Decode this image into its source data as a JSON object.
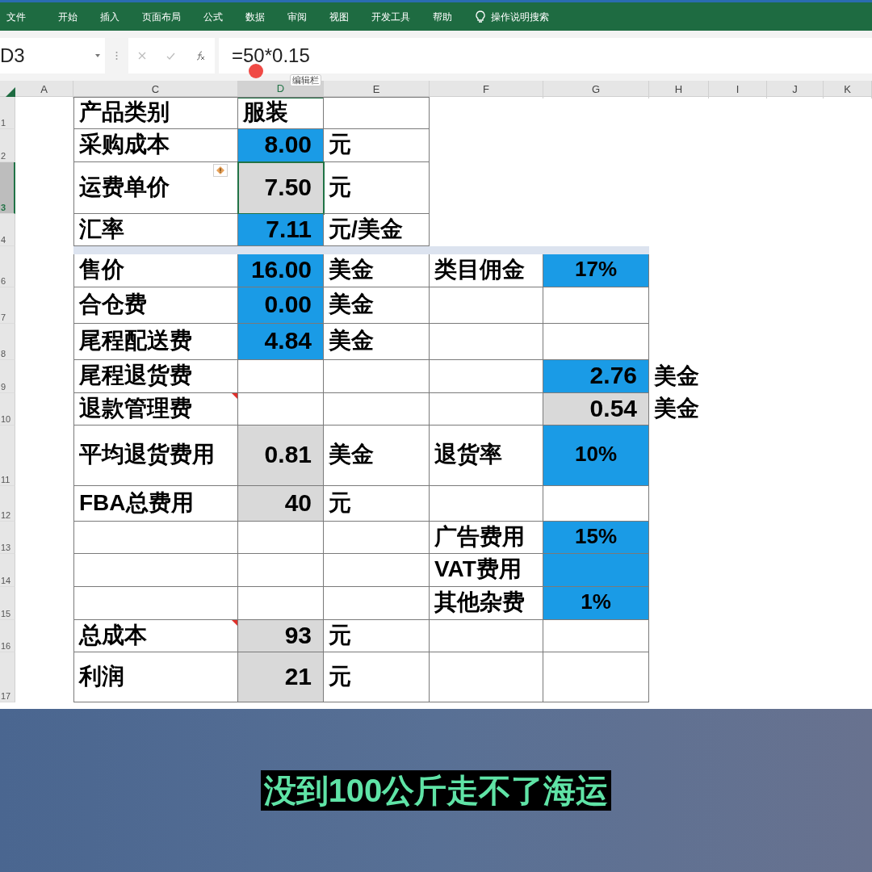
{
  "ribbon": {
    "tabs": [
      "文件",
      "开始",
      "插入",
      "页面布局",
      "公式",
      "数据",
      "审阅",
      "视图",
      "开发工具",
      "帮助"
    ],
    "search": "操作说明搜索"
  },
  "formula_bar": {
    "name_box": "D3",
    "formula": "=50*0.15",
    "tooltip": "编辑栏"
  },
  "columns": [
    {
      "label": "A",
      "selected": false
    },
    {
      "label": "C",
      "selected": false
    },
    {
      "label": "D",
      "selected": true
    },
    {
      "label": "E",
      "selected": false
    },
    {
      "label": "F",
      "selected": false
    },
    {
      "label": "G",
      "selected": false
    },
    {
      "label": "H",
      "selected": false
    },
    {
      "label": "I",
      "selected": false
    },
    {
      "label": "J",
      "selected": false
    },
    {
      "label": "K",
      "selected": false
    }
  ],
  "rows": [
    {
      "number": "1",
      "selected": false,
      "cells": [
        null,
        {
          "kind": "label",
          "text": "产品类别"
        },
        {
          "kind": "label",
          "text": "服装"
        },
        {
          "kind": "blank"
        },
        null,
        null,
        null,
        null,
        null,
        null
      ]
    },
    {
      "number": "2",
      "selected": false,
      "cells": [
        null,
        {
          "kind": "label",
          "text": "采购成本"
        },
        {
          "kind": "number",
          "text": "8.00",
          "color": "#1a9be6"
        },
        {
          "kind": "label",
          "text": "元"
        },
        null,
        null,
        null,
        null,
        null,
        null
      ]
    },
    {
      "number": "3",
      "selected": true,
      "cells": [
        null,
        {
          "kind": "label",
          "text": "运费单价",
          "warning": true
        },
        {
          "kind": "number",
          "text": "7.50",
          "color": "#d9d9d9"
        },
        {
          "kind": "label",
          "text": "元"
        },
        null,
        null,
        null,
        null,
        null,
        null
      ]
    },
    {
      "number": "4",
      "selected": false,
      "cells": [
        null,
        {
          "kind": "label",
          "text": "汇率"
        },
        {
          "kind": "number",
          "text": "7.11",
          "color": "#1a9be6"
        },
        {
          "kind": "label",
          "text": "元/美金"
        },
        null,
        null,
        null,
        null,
        null,
        null
      ]
    },
    {
      "kind": "band",
      "selected": false
    },
    {
      "number": "6",
      "selected": false,
      "cells": [
        null,
        {
          "kind": "label",
          "text": "售价"
        },
        {
          "kind": "number",
          "text": "16.00",
          "color": "#1a9be6"
        },
        {
          "kind": "label",
          "text": "美金"
        },
        {
          "kind": "label",
          "text": "类目佣金"
        },
        {
          "kind": "percent",
          "text": "17%",
          "color": "#1a9be6"
        },
        null,
        null,
        null,
        null
      ]
    },
    {
      "number": "7",
      "selected": false,
      "cells": [
        null,
        {
          "kind": "label",
          "text": "合仓费"
        },
        {
          "kind": "number",
          "text": "0.00",
          "color": "#1a9be6"
        },
        {
          "kind": "label",
          "text": "美金"
        },
        {
          "kind": "blank"
        },
        {
          "kind": "blank"
        },
        null,
        null,
        null,
        null
      ]
    },
    {
      "number": "8",
      "selected": false,
      "cells": [
        null,
        {
          "kind": "label",
          "text": "尾程配送费"
        },
        {
          "kind": "number",
          "text": "4.84",
          "color": "#1a9be6"
        },
        {
          "kind": "label",
          "text": "美金"
        },
        {
          "kind": "blank"
        },
        {
          "kind": "blank"
        },
        null,
        null,
        null,
        null
      ]
    },
    {
      "number": "9",
      "selected": false,
      "cells": [
        null,
        {
          "kind": "label",
          "text": "尾程退货费"
        },
        {
          "kind": "blank"
        },
        {
          "kind": "blank"
        },
        {
          "kind": "blank"
        },
        {
          "kind": "number",
          "text": "2.76",
          "color": "#1a9be6"
        },
        {
          "kind": "note",
          "text": "美金"
        },
        null,
        null,
        null
      ]
    },
    {
      "number": "10",
      "selected": false,
      "cells": [
        null,
        {
          "kind": "label",
          "text": "退款管理费",
          "comment": true
        },
        {
          "kind": "blank"
        },
        {
          "kind": "blank"
        },
        {
          "kind": "blank"
        },
        {
          "kind": "number",
          "text": "0.54",
          "color": "#d9d9d9"
        },
        {
          "kind": "note",
          "text": "美金"
        },
        null,
        null,
        null
      ]
    },
    {
      "number": "11",
      "selected": false,
      "cells": [
        null,
        {
          "kind": "label",
          "text": "平均退货费用"
        },
        {
          "kind": "number",
          "text": "0.81",
          "color": "#d9d9d9"
        },
        {
          "kind": "label",
          "text": "美金"
        },
        {
          "kind": "label",
          "text": "退货率"
        },
        {
          "kind": "percent",
          "text": "10%",
          "color": "#1a9be6"
        },
        null,
        null,
        null,
        null
      ]
    },
    {
      "number": "12",
      "selected": false,
      "cells": [
        null,
        {
          "kind": "label",
          "text": "FBA总费用"
        },
        {
          "kind": "number",
          "text": "40",
          "color": "#d9d9d9"
        },
        {
          "kind": "label",
          "text": "元"
        },
        {
          "kind": "blank"
        },
        {
          "kind": "blank"
        },
        null,
        null,
        null,
        null
      ]
    },
    {
      "number": "13",
      "selected": false,
      "cells": [
        null,
        {
          "kind": "blank"
        },
        {
          "kind": "blank"
        },
        {
          "kind": "blank"
        },
        {
          "kind": "label",
          "text": "广告费用"
        },
        {
          "kind": "percent",
          "text": "15%",
          "color": "#1a9be6"
        },
        null,
        null,
        null,
        null
      ]
    },
    {
      "number": "14",
      "selected": false,
      "cells": [
        null,
        {
          "kind": "blank"
        },
        {
          "kind": "blank"
        },
        {
          "kind": "blank"
        },
        {
          "kind": "label",
          "text": "VAT费用"
        },
        {
          "kind": "blank",
          "color": "#1a9be6"
        },
        null,
        null,
        null,
        null
      ]
    },
    {
      "number": "15",
      "selected": false,
      "cells": [
        null,
        {
          "kind": "blank"
        },
        {
          "kind": "blank"
        },
        {
          "kind": "blank"
        },
        {
          "kind": "label",
          "text": "其他杂费"
        },
        {
          "kind": "percent",
          "text": "1%",
          "color": "#1a9be6"
        },
        null,
        null,
        null,
        null
      ]
    },
    {
      "number": "16",
      "selected": false,
      "cells": [
        null,
        {
          "kind": "label",
          "text": "总成本",
          "comment": true
        },
        {
          "kind": "number",
          "text": "93",
          "color": "#d9d9d9"
        },
        {
          "kind": "label",
          "text": "元"
        },
        {
          "kind": "blank"
        },
        {
          "kind": "blank"
        },
        null,
        null,
        null,
        null
      ]
    },
    {
      "number": "17",
      "selected": false,
      "cells": [
        null,
        {
          "kind": "label",
          "text": "利润"
        },
        {
          "kind": "number",
          "text": "21",
          "color": "#d9d9d9"
        },
        {
          "kind": "label",
          "text": "元"
        },
        {
          "kind": "blank"
        },
        {
          "kind": "blank"
        },
        null,
        null,
        null,
        null
      ]
    }
  ],
  "subtitle": "没到100公斤走不了海运"
}
